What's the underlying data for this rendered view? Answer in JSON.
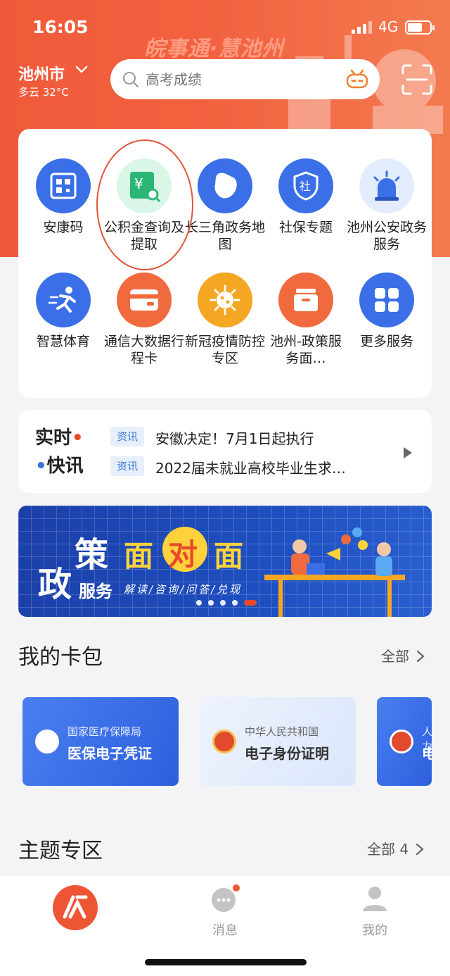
{
  "status_bar": {
    "time": "16:05",
    "network": "4G"
  },
  "header": {
    "brand_watermark": "皖事通·慧池州",
    "city": "池州市",
    "weather": "多云 32°C",
    "search_placeholder": "高考成绩"
  },
  "services": [
    {
      "label": "安康码",
      "icon": "qr-code-icon",
      "color": "#3a6fe8"
    },
    {
      "label": "公积金查询及提取",
      "icon": "fund-search-icon",
      "color": "#2bb673"
    },
    {
      "label": "长三角政务地图",
      "icon": "map-icon",
      "color": "#3a6fe8"
    },
    {
      "label": "社保专题",
      "icon": "shield-icon",
      "color": "#3a6fe8"
    },
    {
      "label": "池州公安政务服务",
      "icon": "police-light-icon",
      "color": "#3a6fe8"
    },
    {
      "label": "智慧体育",
      "icon": "runner-icon",
      "color": "#3a6fe8"
    },
    {
      "label": "通信大数据行程卡",
      "icon": "card-icon",
      "color": "#f06a3e"
    },
    {
      "label": "新冠疫情防控专区",
      "icon": "virus-icon",
      "color": "#f5a623"
    },
    {
      "label": "池州-政策服务面…",
      "icon": "inbox-icon",
      "color": "#f06a3e"
    },
    {
      "label": "更多服务",
      "icon": "grid-icon",
      "color": "#3a6fe8"
    }
  ],
  "news": {
    "logo_line1": "实时",
    "logo_line2": "快讯",
    "items": [
      {
        "tag": "资讯",
        "text": "安徽决定！7月1日起执行"
      },
      {
        "tag": "资讯",
        "text": "2022届未就业高校毕业生求…"
      }
    ]
  },
  "banner": {
    "zheng": "政",
    "ce": "策",
    "mian1": "面",
    "dui": "对",
    "mian2": "面",
    "fuwu": "服务",
    "subtitle": "解读/咨询/问答/兑现"
  },
  "wallet": {
    "title": "我的卡包",
    "all_label": "全部",
    "cards": [
      {
        "subtitle": "国家医疗保障局",
        "title": "医保电子凭证"
      },
      {
        "subtitle": "中华人民共和国",
        "title": "电子身份证明"
      },
      {
        "subtitle": "人力",
        "title": "电"
      }
    ]
  },
  "topics": {
    "title": "主题专区",
    "all_label": "全部 4"
  },
  "tabbar": {
    "messages": "消息",
    "mine": "我的"
  }
}
